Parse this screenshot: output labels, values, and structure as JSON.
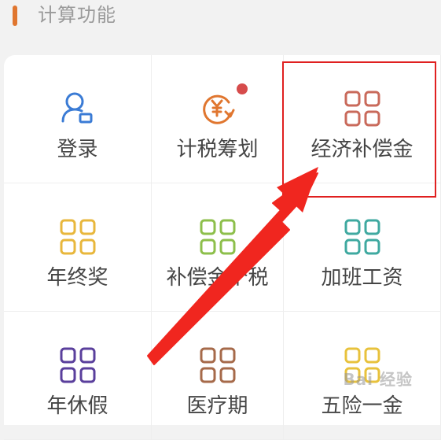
{
  "section": {
    "title": "计算功能",
    "accent_color": "#e0762f"
  },
  "grid": {
    "items": [
      {
        "label": "登录",
        "icon": "user-login-icon",
        "color": "#3a7bd5"
      },
      {
        "label": "计税筹划",
        "icon": "yuan-refresh-icon",
        "color": "#e0762f",
        "badge": "dot"
      },
      {
        "label": "经济补偿金",
        "icon": "grid-icon",
        "color": "#c96a5b",
        "highlighted": true
      },
      {
        "label": "年终奖",
        "icon": "grid-icon",
        "color": "#e8b73c"
      },
      {
        "label": "补偿金个税",
        "icon": "grid-icon",
        "color": "#8dbf4b"
      },
      {
        "label": "加班工资",
        "icon": "grid-icon",
        "color": "#3fa9a0"
      },
      {
        "label": "年休假",
        "icon": "grid-icon",
        "color": "#5a3f9c"
      },
      {
        "label": "医疗期",
        "icon": "grid-icon",
        "color": "#a66a4a"
      },
      {
        "label": "五险一金",
        "icon": "grid-icon",
        "color": "#e8c23c"
      }
    ]
  },
  "annotation": {
    "highlight_color": "#e02020",
    "arrow_color": "#f0261f"
  },
  "watermark": {
    "text": "Bai 经验"
  }
}
